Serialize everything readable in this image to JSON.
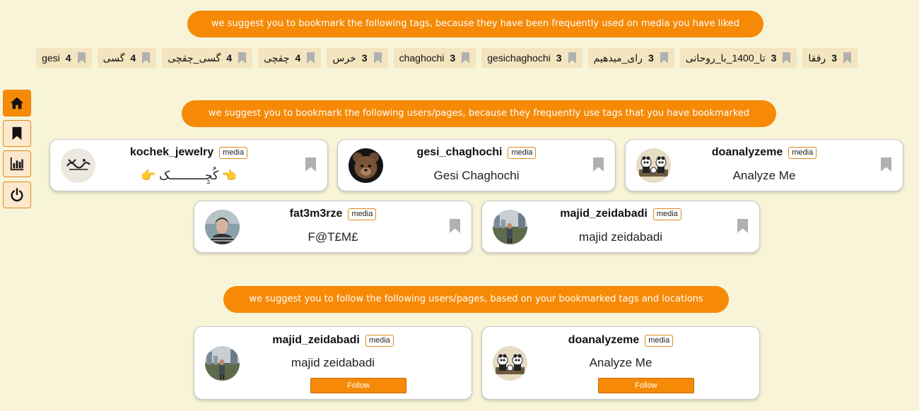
{
  "banners": {
    "tags": "we suggest you to bookmark the following tags, because they have been frequently used on media you have liked",
    "users": "we suggest you to bookmark the following users/pages, because they frequently use tags that you have bookmarked",
    "follow": "we suggest you to follow the following users/pages, based on your bookmarked tags and locations"
  },
  "sidebar": {
    "items": [
      {
        "icon": "home-icon",
        "active": true
      },
      {
        "icon": "bookmark-icon",
        "active": false
      },
      {
        "icon": "bar-chart-icon",
        "active": false
      },
      {
        "icon": "power-icon",
        "active": false
      }
    ]
  },
  "tags": [
    {
      "name": "رفقا",
      "count": "3"
    },
    {
      "name": "تا_1400_با_روحانی",
      "count": "3"
    },
    {
      "name": "رای_میدهیم",
      "count": "3"
    },
    {
      "name": "gesichaghochi",
      "count": "3"
    },
    {
      "name": "chaghochi",
      "count": "3"
    },
    {
      "name": "خرس",
      "count": "3"
    },
    {
      "name": "چقچی",
      "count": "4"
    },
    {
      "name": "گسی_چقچی",
      "count": "4"
    },
    {
      "name": "گسی",
      "count": "4"
    },
    {
      "name": "gesi",
      "count": "4"
    }
  ],
  "bookmark_suggestions": [
    {
      "username": "kochek_jewelry",
      "badge": "media",
      "fullname": "👉 کُچِــــــــــک 👈",
      "avatar": "kochek-logo-avatar"
    },
    {
      "username": "gesi_chaghochi",
      "badge": "media",
      "fullname": "Gesi Chaghochi",
      "avatar": "teddy-bear-avatar"
    },
    {
      "username": "doanalyzeme",
      "badge": "media",
      "fullname": "Analyze Me",
      "avatar": "panda-avatar"
    },
    {
      "username": "fat3m3rze",
      "badge": "media",
      "fullname": "F@T£M£",
      "avatar": "woman-avatar"
    },
    {
      "username": "majid_zeidabadi",
      "badge": "media",
      "fullname": "majid zeidabadi",
      "avatar": "man-outdoor-avatar"
    }
  ],
  "follow_suggestions": [
    {
      "username": "majid_zeidabadi",
      "badge": "media",
      "fullname": "majid zeidabadi",
      "button": "Follow",
      "avatar": "man-outdoor-avatar"
    },
    {
      "username": "doanalyzeme",
      "badge": "media",
      "fullname": "Analyze Me",
      "button": "Follow",
      "avatar": "panda-avatar"
    }
  ],
  "colors": {
    "accent": "#f68a07",
    "background": "#f7f4d8",
    "tag_bg": "#f3e5bf",
    "bookmark_grey": "#b0b0b0"
  }
}
